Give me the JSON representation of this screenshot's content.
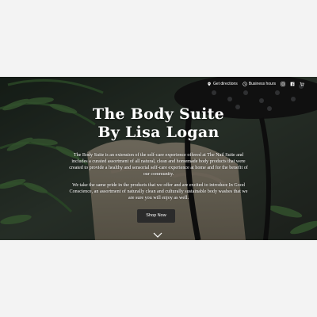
{
  "topbar": {
    "directions_label": "Get directions",
    "hours_label": "Business hours",
    "icons": [
      "map-pin-icon",
      "clock-icon",
      "instagram-icon",
      "facebook-icon",
      "cart-icon"
    ]
  },
  "hero": {
    "title_line1": "The Body Suite",
    "title_line2": "By Lisa Logan",
    "paragraph1": "The Body Suite is an extension of the self-care experience offered at The Nail Suite and includes a curated assortment of all natural, clean and homemade body products that were created to provide a healthy and sensorial self-care experience at home and for the benefit of our community.",
    "paragraph2": "We take the same pride in the products that we offer and are excited to introduce In Good Conscience, an assortment of naturally clean and culturally sustainable body washes that we are sure you will enjoy as well.",
    "cta_label": "Shop Now"
  },
  "colors": {
    "page_background": "#f3f3f3",
    "button_background": "#2b2b2b",
    "text": "#ffffff"
  }
}
